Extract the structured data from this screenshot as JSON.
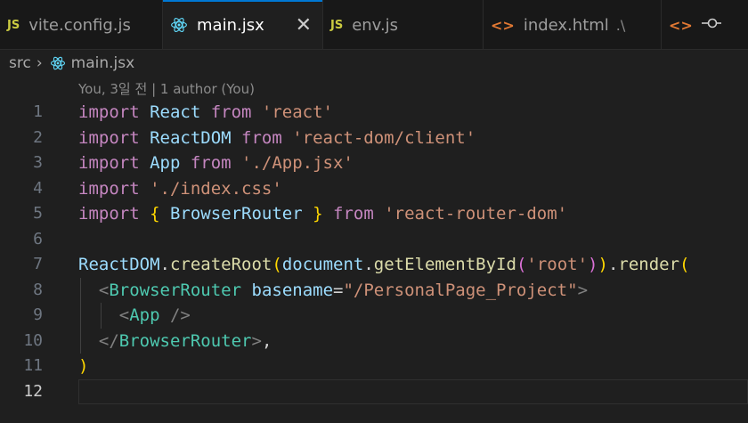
{
  "tabs": [
    {
      "label": "vite.config.js",
      "icon": "js-icon",
      "active": false
    },
    {
      "label": "main.jsx",
      "icon": "react-icon",
      "active": true
    },
    {
      "label": "env.js",
      "icon": "js-icon",
      "active": false
    },
    {
      "label": "index.html",
      "suffix": ".\\",
      "icon": "html-icon",
      "active": false
    },
    {
      "label": "",
      "icon": "html-icon",
      "active": false
    }
  ],
  "breadcrumb": {
    "folder": "src",
    "file": "main.jsx"
  },
  "codelens": "You, 3일 전 | 1 author (You)",
  "lines": [
    {
      "n": "1",
      "tokens": [
        [
          "kw",
          "import "
        ],
        [
          "id",
          "React "
        ],
        [
          "kw",
          "from "
        ],
        [
          "str",
          "'react'"
        ]
      ]
    },
    {
      "n": "2",
      "tokens": [
        [
          "kw",
          "import "
        ],
        [
          "id",
          "ReactDOM "
        ],
        [
          "kw",
          "from "
        ],
        [
          "str",
          "'react-dom/client'"
        ]
      ]
    },
    {
      "n": "3",
      "tokens": [
        [
          "kw",
          "import "
        ],
        [
          "id",
          "App "
        ],
        [
          "kw",
          "from "
        ],
        [
          "str",
          "'./App.jsx'"
        ]
      ]
    },
    {
      "n": "4",
      "tokens": [
        [
          "kw",
          "import "
        ],
        [
          "str",
          "'./index.css'"
        ]
      ]
    },
    {
      "n": "5",
      "tokens": [
        [
          "kw",
          "import "
        ],
        [
          "br1",
          "{ "
        ],
        [
          "id",
          "BrowserRouter "
        ],
        [
          "br1",
          "} "
        ],
        [
          "kw",
          "from "
        ],
        [
          "str",
          "'react-router-dom'"
        ]
      ]
    },
    {
      "n": "6",
      "tokens": []
    },
    {
      "n": "7",
      "tokens": [
        [
          "id",
          "ReactDOM"
        ],
        [
          "txt",
          "."
        ],
        [
          "fn",
          "createRoot"
        ],
        [
          "br1",
          "("
        ],
        [
          "id",
          "document"
        ],
        [
          "txt",
          "."
        ],
        [
          "fn",
          "getElementById"
        ],
        [
          "br2",
          "("
        ],
        [
          "str",
          "'root'"
        ],
        [
          "br2",
          ")"
        ],
        [
          "br1",
          ")"
        ],
        [
          "txt",
          "."
        ],
        [
          "fn",
          "render"
        ],
        [
          "br1",
          "("
        ]
      ]
    },
    {
      "n": "8",
      "tokens": [
        [
          "txt",
          "  "
        ],
        [
          "pun",
          "<"
        ],
        [
          "tag",
          "BrowserRouter "
        ],
        [
          "id",
          "basename"
        ],
        [
          "txt",
          "="
        ],
        [
          "str",
          "\"/PersonalPage_Project\""
        ],
        [
          "pun",
          ">"
        ]
      ]
    },
    {
      "n": "9",
      "tokens": [
        [
          "txt",
          "    "
        ],
        [
          "pun",
          "<"
        ],
        [
          "tag",
          "App "
        ],
        [
          "pun",
          "/>"
        ]
      ]
    },
    {
      "n": "10",
      "tokens": [
        [
          "txt",
          "  "
        ],
        [
          "pun",
          "</"
        ],
        [
          "tag",
          "BrowserRouter"
        ],
        [
          "pun",
          ">"
        ],
        [
          "txt",
          ","
        ]
      ]
    },
    {
      "n": "11",
      "tokens": [
        [
          "br1",
          ")"
        ]
      ]
    },
    {
      "n": "12",
      "tokens": [],
      "current": true
    }
  ]
}
